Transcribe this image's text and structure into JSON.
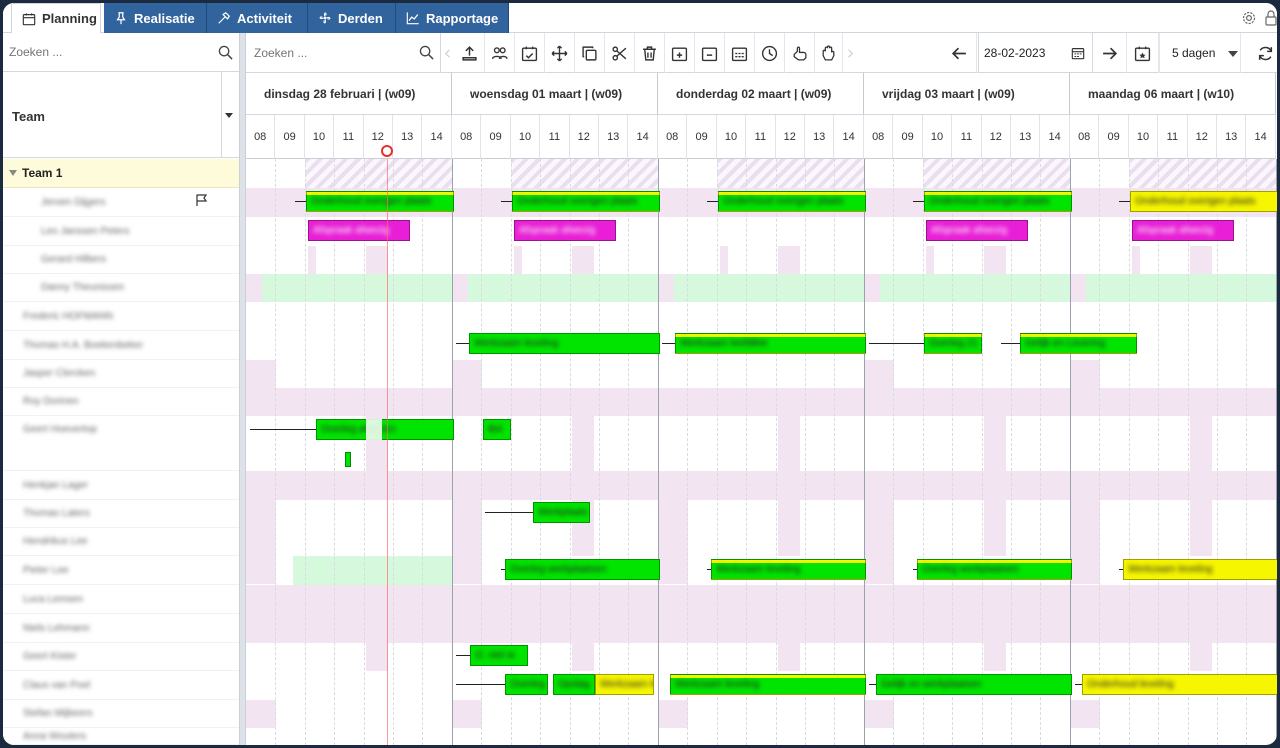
{
  "tabs": [
    {
      "label": "Planning",
      "icon": "calendar-icon",
      "active": true
    },
    {
      "label": "Realisatie",
      "icon": "pin-icon",
      "active": false
    },
    {
      "label": "Activiteit",
      "icon": "hammer-icon",
      "active": false
    },
    {
      "label": "Derden",
      "icon": "fan-icon",
      "active": false
    },
    {
      "label": "Rapportage",
      "icon": "chart-line-icon",
      "active": false
    }
  ],
  "left_search": {
    "placeholder": "Zoeken ..."
  },
  "main_search": {
    "placeholder": "Zoeken ..."
  },
  "team_header": {
    "label": "Team"
  },
  "team_group": {
    "label": "Team 1"
  },
  "toolbar_icons": [
    "chevron-left-icon",
    "upload-icon",
    "people-icon",
    "calendar-check-icon",
    "move-icon",
    "copy-icon",
    "scissors-icon",
    "trash-icon",
    "calendar-plus-icon",
    "calendar-minus-icon",
    "calendar-grid-icon",
    "clock-icon",
    "hand-point-icon",
    "hand-stop-icon",
    "chevron-right-icon"
  ],
  "date_nav": {
    "prev": "arrow-left-icon",
    "date": "28-02-2023",
    "next": "arrow-right-icon",
    "today": "calendar-star-icon"
  },
  "days_select": {
    "value": "5 dagen"
  },
  "refresh": "refresh-icon",
  "days": [
    {
      "label": "dinsdag 28 februari | (w09)",
      "hours": [
        "08",
        "09",
        "10",
        "11",
        "12",
        "13",
        "14"
      ]
    },
    {
      "label": "woensdag 01 maart | (w09)",
      "hours": [
        "08",
        "09",
        "10",
        "11",
        "12",
        "13",
        "14"
      ]
    },
    {
      "label": "donderdag 02 maart | (w09)",
      "hours": [
        "08",
        "09",
        "10",
        "11",
        "12",
        "13",
        "14"
      ]
    },
    {
      "label": "vrijdag 03 maart | (w09)",
      "hours": [
        "08",
        "09",
        "10",
        "11",
        "12",
        "13",
        "14"
      ]
    },
    {
      "label": "maandag 06 maart | (w10)",
      "hours": [
        "08",
        "09",
        "10",
        "11",
        "12",
        "13",
        "14"
      ]
    }
  ],
  "resources": [
    {
      "name": "Jeroen Dijgers",
      "indent": true,
      "flag": true
    },
    {
      "name": "Leo Janssen Peters",
      "indent": true
    },
    {
      "name": "Gerard Hilbers",
      "indent": true
    },
    {
      "name": "Danny Theunissen",
      "indent": true
    },
    {
      "name": "Frederic HOFMANN"
    },
    {
      "name": "Thomas H.A. Boekenbeker"
    },
    {
      "name": "Jasper Clercken"
    },
    {
      "name": "Roy Dorinen"
    },
    {
      "name": "Geert Hoevertop"
    },
    {
      "name": "Henkjan Lager"
    },
    {
      "name": "Thomas Laters"
    },
    {
      "name": "Hendrikus Lee"
    },
    {
      "name": "Pieter Lee"
    },
    {
      "name": "Luca Lemsen"
    },
    {
      "name": "Niels Lehmann"
    },
    {
      "name": "Geert Kister"
    },
    {
      "name": "Claus van Poel"
    },
    {
      "name": "Stefan Mijbeers"
    },
    {
      "name": "Anna Wouters"
    }
  ],
  "events": [
    {
      "row": 0,
      "label": "Onderhoud overigen plaats"
    },
    {
      "row": 1,
      "label": "Afspraak afwezig"
    },
    {
      "row": 5,
      "label": "Werkzaam leveling"
    },
    {
      "row": 5,
      "label": "Werkzaam leefdikte"
    },
    {
      "row": 5,
      "label": "Overleg 21"
    },
    {
      "row": 5,
      "label": "Gelijk en Levering"
    },
    {
      "row": 8,
      "label": "Overleg afwezen"
    },
    {
      "row": 8,
      "label": "Bel"
    },
    {
      "row": 10,
      "label": "Werkplaats"
    },
    {
      "row": 12,
      "label": "Overleg werkplaatsen"
    },
    {
      "row": 12,
      "label": "Werkzaam leveling"
    },
    {
      "row": 12,
      "label": "Overleg werkplaatsen"
    },
    {
      "row": 12,
      "label": "Werkzaam leveling"
    },
    {
      "row": 15,
      "label": "O. niet w"
    },
    {
      "row": 16,
      "label": "Overleg"
    },
    {
      "row": 16,
      "label": "Opslag"
    },
    {
      "row": 16,
      "label": "Werkzaam leveling"
    },
    {
      "row": 16,
      "label": "Gelijk en werkplaatsen"
    },
    {
      "row": 16,
      "label": "Onderhoud leveling"
    }
  ],
  "colors": {
    "green": "#00e400",
    "yellow": "#f6f600",
    "magenta": "#e81fd6",
    "pink": "#f3e4f1",
    "lightgreen": "#d6f8dc",
    "accent": "#31639c"
  }
}
